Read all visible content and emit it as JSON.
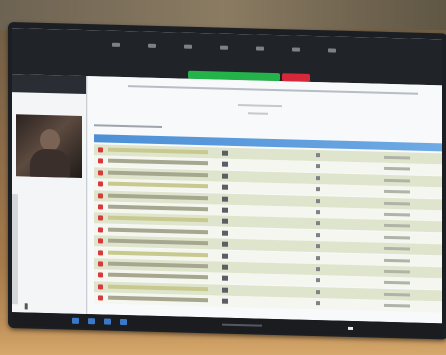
{
  "meeting": {
    "share_status": "",
    "stop_label": ""
  },
  "document": {
    "title": "",
    "subtitle": "",
    "section": ""
  },
  "table": {
    "rows": 14
  },
  "colors": {
    "share_bar": "#24b34a",
    "stop_button": "#d6283a",
    "table_header": "#4d8fd6",
    "row_bullet": "#d63a3a",
    "row_alt": "#dfe5cc"
  },
  "icons": [
    "mute-icon",
    "video-icon",
    "security-icon",
    "participants-icon",
    "share-icon",
    "record-icon",
    "more-icon"
  ]
}
